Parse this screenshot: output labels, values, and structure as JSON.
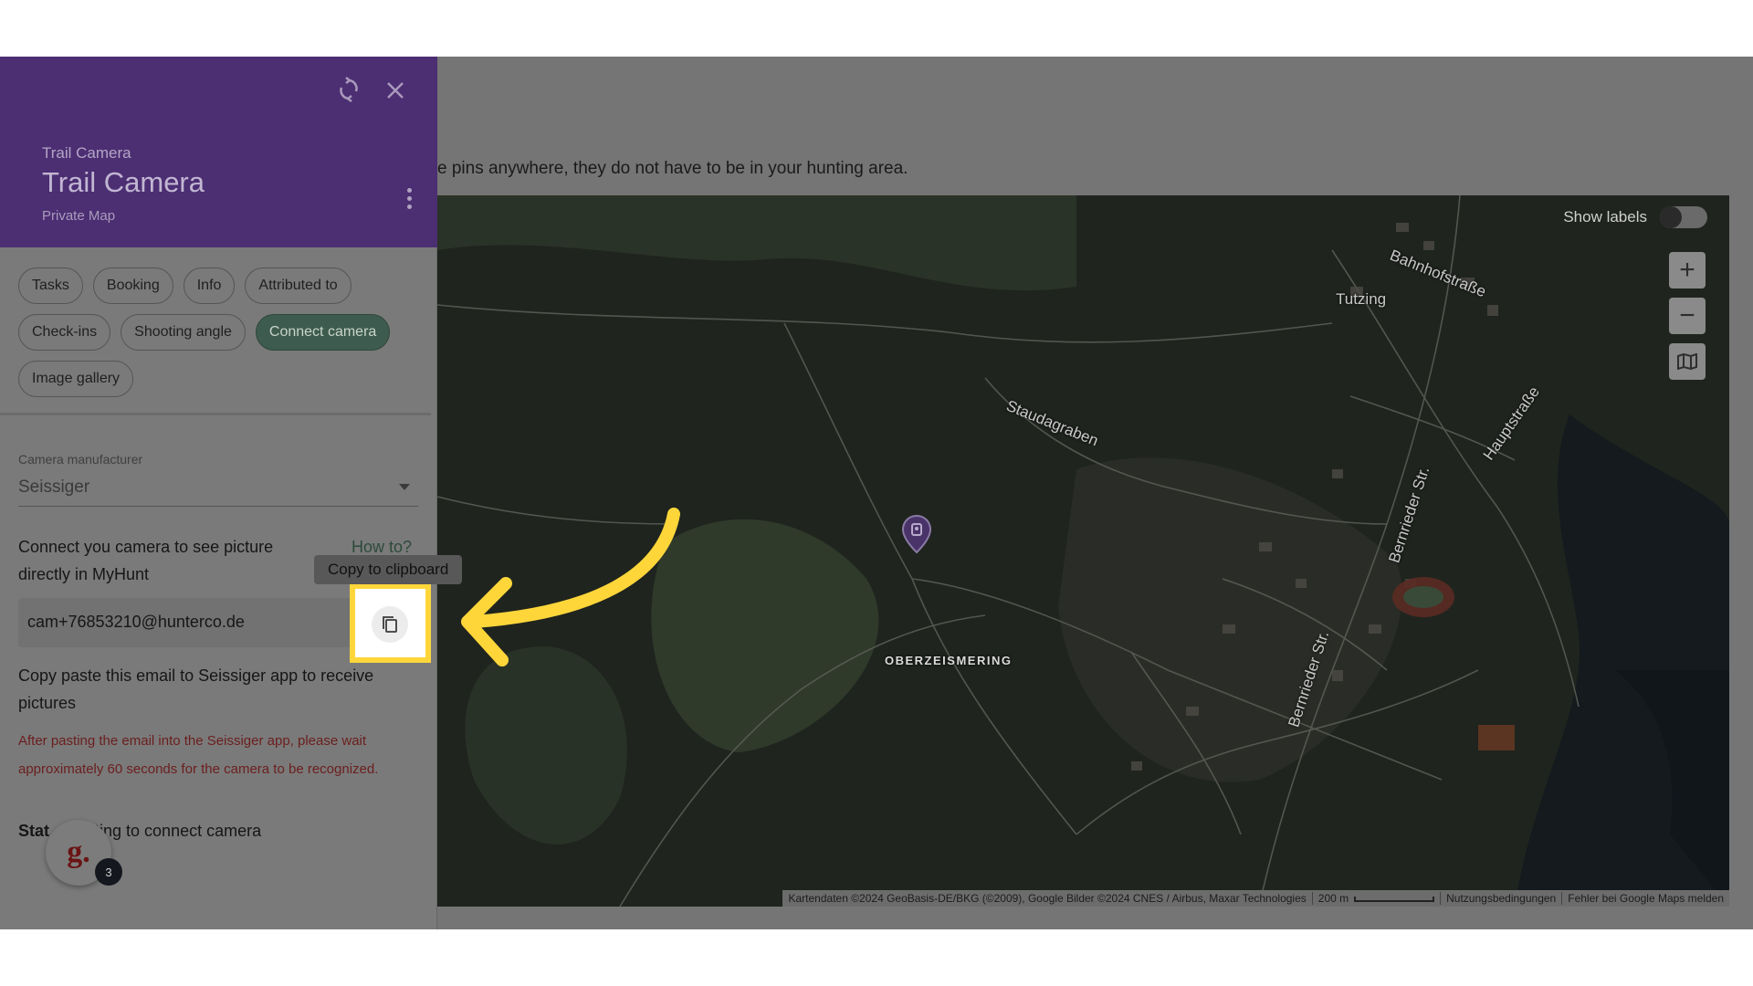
{
  "panel": {
    "header": {
      "type_label": "Trail Camera",
      "title": "Trail Camera",
      "subtitle": "Private Map",
      "icons": [
        "refresh-icon",
        "close-icon",
        "more-vert-icon"
      ],
      "color": "#4c2e73"
    },
    "chips": [
      "Tasks",
      "Booking",
      "Info",
      "Attributed to",
      "Check-ins",
      "Shooting angle",
      "Connect camera",
      "Image gallery"
    ],
    "active_chip": "Connect camera",
    "manufacturer": {
      "label": "Camera manufacturer",
      "value": "Seissiger"
    },
    "connect_text": "Connect you camera to see picture directly in MyHunt",
    "how_to": "How to?",
    "tooltip": "Copy to clipboard",
    "email": "cam+76853210@hunterco.de",
    "copy_note": "Copy paste this email to Seissiger app to receive pictures",
    "warning": "After pasting the email into the Seissiger app, please wait approximately 60 seconds for the camera to be recognized.",
    "status_label": "Stat",
    "status_text": "ting to connect camera",
    "avatar": {
      "letter": "g.",
      "badge": "3"
    }
  },
  "background": {
    "instruction": "e pins anywhere, they do not have to be in your hunting area."
  },
  "map": {
    "show_labels": "Show labels",
    "zoom_in": "+",
    "zoom_out": "−",
    "labels": {
      "tutzing": "Tutzing",
      "bahnhofstrasse": "Bahnhofstraße",
      "staudagraben": "Staudagraben",
      "hauptstrasse": "Hauptstraße",
      "bernrieder1": "Bernrieder Str.",
      "bernrieder2": "Bernrieder Str.",
      "oberzeismering": "OBERZEISMERING"
    },
    "footer": {
      "attribution": "Kartendaten ©2024 GeoBasis-DE/BKG (©2009), Google Bilder ©2024 CNES / Airbus, Maxar Technologies",
      "scale": "200 m",
      "terms": "Nutzungsbedingungen",
      "report": "Fehler bei Google Maps melden"
    }
  },
  "colors": {
    "highlight": "#ffd63a",
    "arrow": "#ffd63a",
    "chip_active": "#3d5b4e",
    "warning": "#6c1e1e"
  }
}
